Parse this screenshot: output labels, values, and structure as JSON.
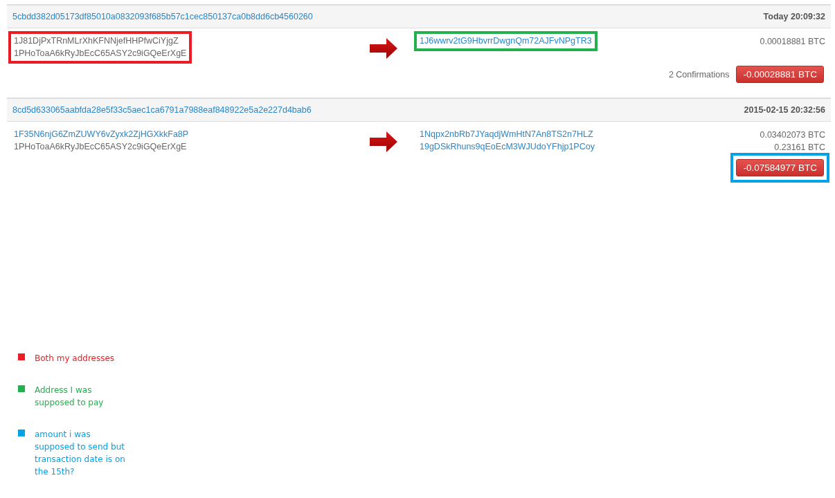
{
  "transactions": [
    {
      "hash": "5cbdd382d05173df85010a0832093f685b57c1cec850137ca0b8dd6cb4560260",
      "time": "Today 20:09:32",
      "inputs_frame": {
        "color": "#ed1c24"
      },
      "outputs_frame": {
        "color": "#22b14c"
      },
      "inputs": [
        {
          "address": "1J81DjPxTRnMLrXhKFNNjefHHPfwCiYjgZ",
          "linked": false
        },
        {
          "address": "1PHoToaA6kRyJbEcC65ASY2c9iGQeErXgE",
          "linked": false
        }
      ],
      "outputs": [
        {
          "address": "1J6wwrv2tG9HbvrrDwgnQm72AJFvNPgTR3",
          "amount": "0.00018881 BTC"
        }
      ],
      "confirmations": "2 Confirmations",
      "total": "-0.00028881 BTC"
    },
    {
      "hash": "8cd5d633065aabfda28e5f33c5aec1ca6791a7988eaf848922e5a2e227d4bab6",
      "time": "2015-02-15 20:32:56",
      "total_frame": {
        "color": "#00a2e8"
      },
      "inputs": [
        {
          "address": "1F35N6njG6ZmZUWY6vZyxk2ZjHGXkkFa8P",
          "linked": true
        },
        {
          "address": "1PHoToaA6kRyJbEcC65ASY2c9iGQeErXgE",
          "linked": false
        }
      ],
      "outputs": [
        {
          "address": "1Nqpx2nbRb7JYaqdjWmHtN7An8TS2n7HLZ",
          "amount": "0.03402073 BTC"
        },
        {
          "address": "19gDSkRhuns9qEoEcM3WJUdoYFhjp1PCoy",
          "amount": "0.23161 BTC"
        }
      ],
      "total": "-0.07584977 BTC"
    }
  ],
  "legend": [
    {
      "color": "#ed1c24",
      "text": "Both my addresses"
    },
    {
      "color": "#22b14c",
      "text": "Address I was supposed to pay"
    },
    {
      "color": "#00a2e8",
      "text": "amount i was supposed to send but transaction date is on the 15th?"
    }
  ]
}
